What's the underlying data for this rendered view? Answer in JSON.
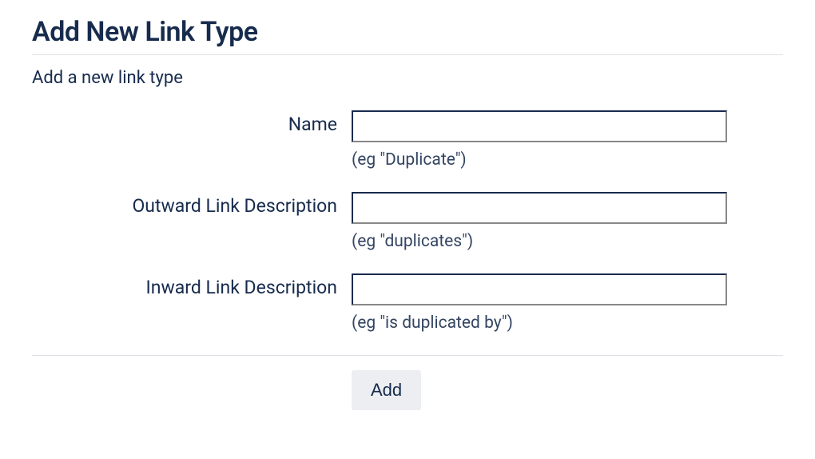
{
  "header": {
    "title": "Add New Link Type",
    "subtitle": "Add a new link type"
  },
  "form": {
    "fields": [
      {
        "label": "Name",
        "value": "",
        "hint": "(eg \"Duplicate\")"
      },
      {
        "label": "Outward Link Description",
        "value": "",
        "hint": "(eg \"duplicates\")"
      },
      {
        "label": "Inward Link Description",
        "value": "",
        "hint": "(eg \"is duplicated by\")"
      }
    ],
    "submit_label": "Add"
  }
}
